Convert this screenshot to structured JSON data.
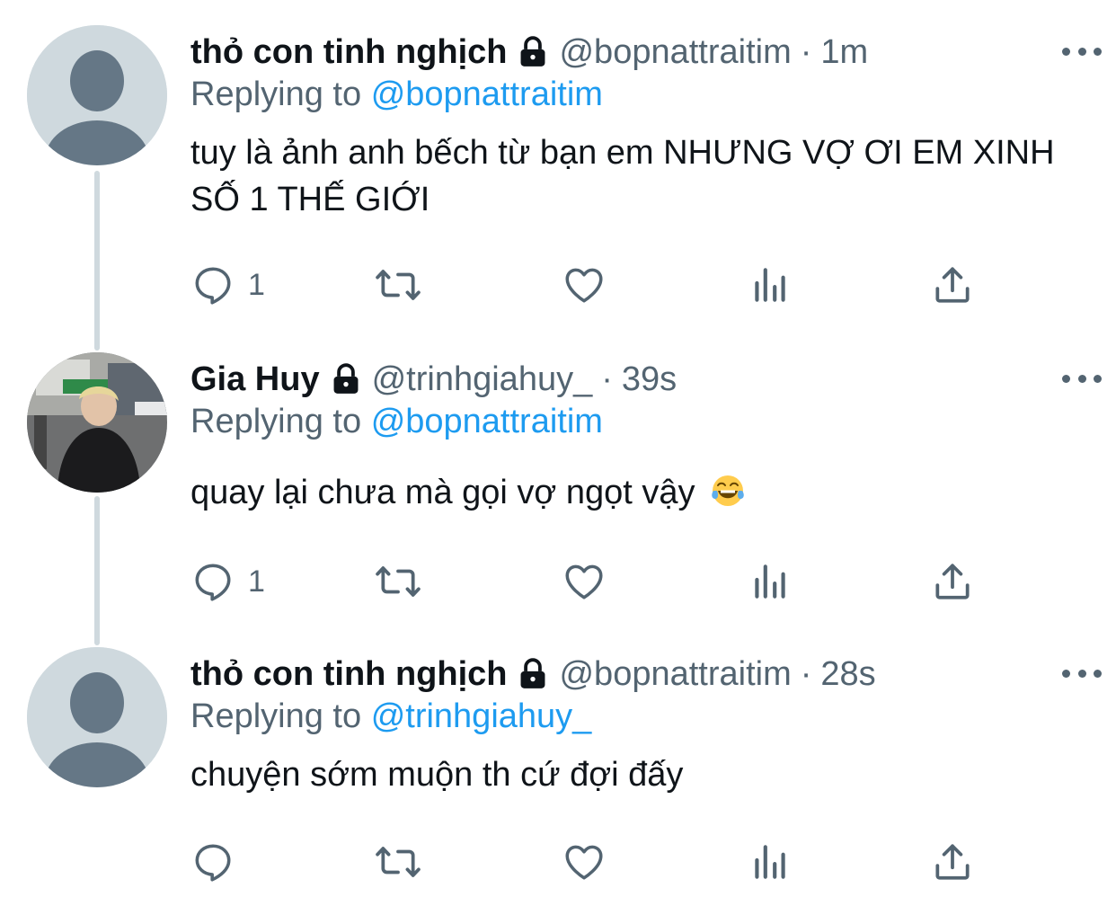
{
  "tweets": [
    {
      "name": "thỏ con tinh nghịch",
      "handle": "@bopnattraitim",
      "separator": "·",
      "time": "1m",
      "replying_label": "Replying to",
      "replying_to": "@bopnattraitim",
      "text": "tuy là ảnh anh bếch từ bạn em NHƯNG VỢ ƠI EM XINH SỐ 1 THẾ GIỚI",
      "reply_count": "1"
    },
    {
      "name": "Gia Huy",
      "handle": "@trinhgiahuy_",
      "separator": "·",
      "time": "39s",
      "replying_label": "Replying to",
      "replying_to": "@bopnattraitim",
      "text": "quay lại chưa mà gọi vợ ngọt vậy",
      "text_emoji": "laughing-crying-face",
      "reply_count": "1"
    },
    {
      "name": "thỏ con tinh nghịch",
      "handle": "@bopnattraitim",
      "separator": "·",
      "time": "28s",
      "replying_label": "Replying to",
      "replying_to": "@trinhgiahuy_",
      "text": "chuyện sớm muộn th cứ đợi đấy",
      "reply_count": ""
    }
  ],
  "colors": {
    "text_primary": "#0f1419",
    "text_secondary": "#536471",
    "mention": "#1d9bf0",
    "thread_line": "#cfd9de",
    "default_avatar_bg": "#cfd9de",
    "default_avatar_fg": "#657786"
  },
  "icons": {
    "lock": "lock-icon",
    "more": "more-icon",
    "reply": "reply-icon",
    "retweet": "retweet-icon",
    "like": "heart-icon",
    "analytics": "analytics-icon",
    "share": "share-icon"
  }
}
